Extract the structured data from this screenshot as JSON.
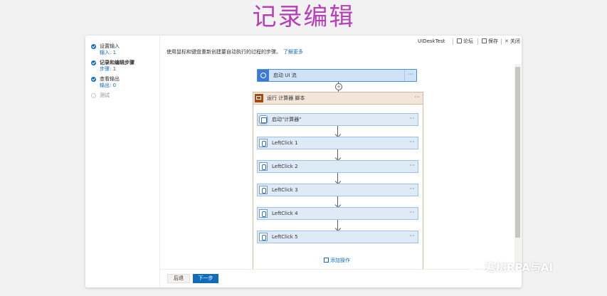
{
  "banner": {
    "title": "记录编辑"
  },
  "steps": [
    {
      "label": "设置输入",
      "sub": "输入: 1",
      "state": "done"
    },
    {
      "label": "记录和编辑步骤",
      "sub": "步骤: 1",
      "state": "done"
    },
    {
      "label": "查看输出",
      "sub": "输出: 0",
      "state": "done"
    },
    {
      "label": "测试",
      "sub": "",
      "state": "todo"
    }
  ],
  "topbar": {
    "flow_name": "UIDeskTest",
    "comments_label": "论坛",
    "save_label": "保存",
    "close_label": "关闭"
  },
  "instruction": {
    "text": "使用鼠标和键盘重新创建要自动执行的过程的步骤。",
    "link": "了解更多"
  },
  "trigger": {
    "label": "启动 UI 流",
    "more": "···"
  },
  "script": {
    "label": "运行 计算器 脚本",
    "more": "···",
    "actions": [
      {
        "label": "启动\"计算器\"",
        "icon": "window-icon"
      },
      {
        "label": "LeftClick 1",
        "icon": "mouse-icon"
      },
      {
        "label": "LeftClick 2",
        "icon": "mouse-icon"
      },
      {
        "label": "LeftClick 3",
        "icon": "mouse-icon"
      },
      {
        "label": "LeftClick 4",
        "icon": "mouse-icon"
      },
      {
        "label": "LeftClick 5",
        "icon": "mouse-icon"
      }
    ]
  },
  "add_action": {
    "label": "添加操作"
  },
  "footer": {
    "back_label": "后退",
    "next_label": "下一步"
  },
  "watermark": {
    "text": "寒树RPA与AI"
  },
  "colors": {
    "accent": "#0f6cbd",
    "banner": "#b540b8",
    "script_header": "#f3e5da"
  }
}
